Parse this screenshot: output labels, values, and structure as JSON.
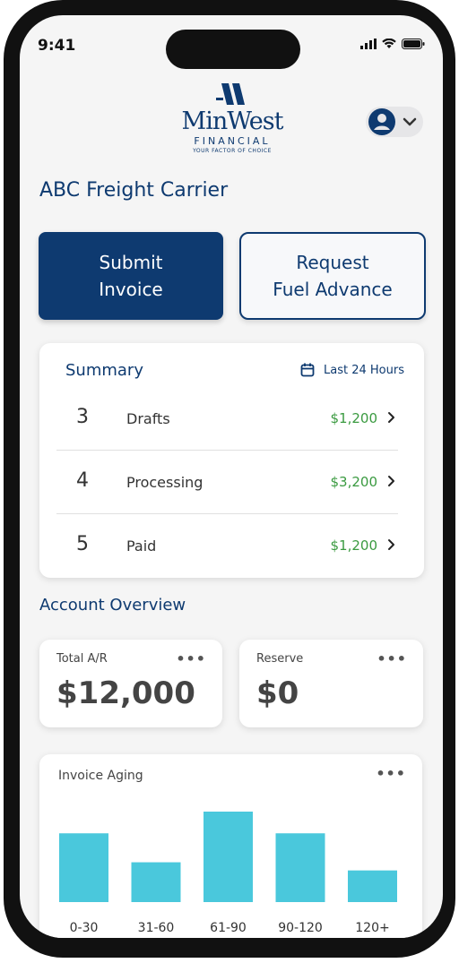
{
  "status_bar": {
    "time": "9:41"
  },
  "logo": {
    "name": "MinWest",
    "sub": "FINANCIAL",
    "tagline": "YOUR FACTOR OF CHOICE"
  },
  "company_name": "ABC Freight Carrier",
  "actions": {
    "submit_invoice": "Submit\nInvoice",
    "request_fuel": "Request\nFuel Advance"
  },
  "summary": {
    "title": "Summary",
    "range_label": "Last 24 Hours",
    "rows": [
      {
        "count": "3",
        "label": "Drafts",
        "amount": "$1,200"
      },
      {
        "count": "4",
        "label": "Processing",
        "amount": "$3,200"
      },
      {
        "count": "5",
        "label": "Paid",
        "amount": "$1,200"
      }
    ]
  },
  "account_overview": {
    "title": "Account Overview",
    "total_ar": {
      "label": "Total A/R",
      "value": "$12,000"
    },
    "reserve": {
      "label": "Reserve",
      "value": "$0"
    }
  },
  "chart_data": {
    "type": "bar",
    "title": "Invoice Aging",
    "categories": [
      "0-30",
      "31-60",
      "61-90",
      "90-120",
      "120+"
    ],
    "values": [
      76,
      44,
      100,
      76,
      35
    ],
    "color": "#4ac8dc"
  },
  "colors": {
    "brand": "#0e3a70",
    "positive": "#3a9a40",
    "bar": "#4ac8dc"
  }
}
